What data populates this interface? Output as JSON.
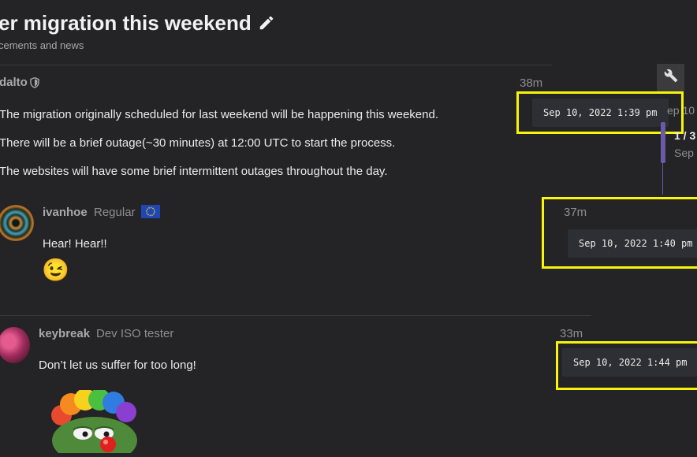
{
  "topic": {
    "title": "er migration this weekend",
    "category": "cements and news"
  },
  "posts": [
    {
      "username": "dalto",
      "relative_time": "38m",
      "paragraphs": [
        "The migration originally scheduled for last weekend will be happening this weekend.",
        "There will be a brief outage(~30 minutes) at 12:00 UTC to start the process.",
        "The websites will have some brief intermittent outages throughout the day."
      ],
      "tooltip": "Sep 10, 2022 1:39 pm"
    },
    {
      "username": "ivanhoe",
      "flair": "Regular",
      "relative_time": "37m",
      "text": "Hear! Hear!!",
      "emoji": "😉",
      "tooltip": "Sep 10, 2022 1:40 pm"
    },
    {
      "username": "keybreak",
      "flair": "Dev ISO tester",
      "relative_time": "33m",
      "text": "Don’t let us suffer for too long!",
      "tooltip": "Sep 10, 2022 1:44 pm"
    }
  ],
  "timeline": {
    "start_date": "ep 10",
    "position": "1 / 3",
    "current_date": "Sep"
  },
  "icons": {
    "edit": "pencil-icon",
    "moderator": "shield-icon",
    "admin_tools": "wrench-icon",
    "flag": "eu-flag-icon"
  },
  "colors": {
    "background": "#242325",
    "highlight": "#f7f40c",
    "timeline_accent": "#6a5aa8"
  }
}
